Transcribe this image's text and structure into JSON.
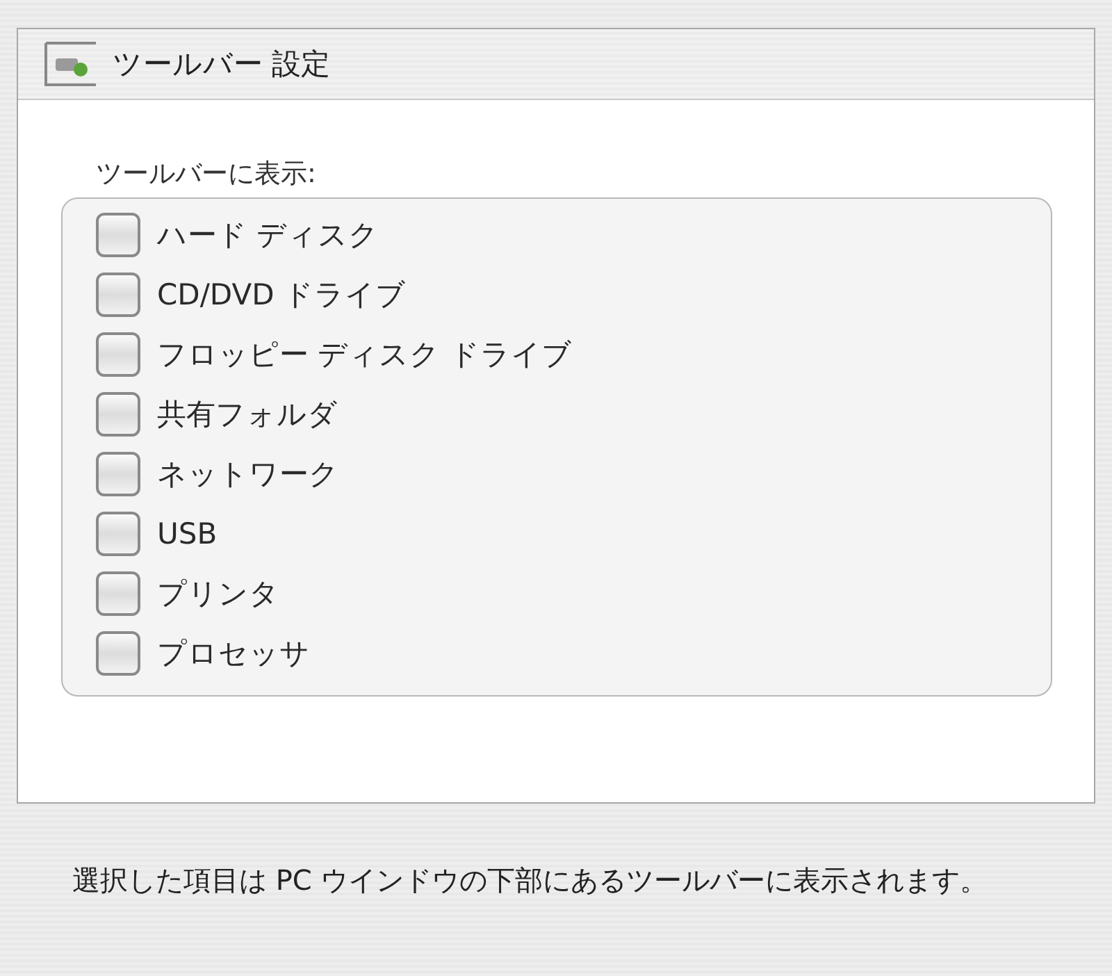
{
  "panel": {
    "title": "ツールバー 設定"
  },
  "group": {
    "label": "ツールバーに表示:",
    "items": [
      {
        "label": "ハード ディスク",
        "checked": false
      },
      {
        "label": "CD/DVD ドライブ",
        "checked": false
      },
      {
        "label": "フロッピー ディスク ドライブ",
        "checked": false
      },
      {
        "label": "共有フォルダ",
        "checked": false
      },
      {
        "label": "ネットワーク",
        "checked": false
      },
      {
        "label": "USB",
        "checked": false
      },
      {
        "label": "プリンタ",
        "checked": false
      },
      {
        "label": "プロセッサ",
        "checked": false
      }
    ]
  },
  "note": "選択した項目は PC ウインドウの下部にあるツールバーに表示されます。"
}
